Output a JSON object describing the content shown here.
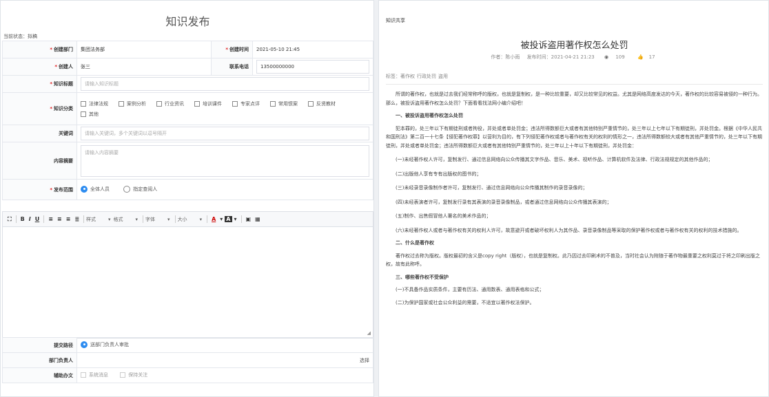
{
  "form": {
    "title": "知识发布",
    "status": "当前状态：拟稿",
    "fields": {
      "dept_label": "创建部门",
      "dept_value": "集团法务部",
      "time_label": "创建时间",
      "time_value": "2021-05-10 21:45",
      "creator_label": "创建人",
      "creator_value": "张三",
      "phone_label": "联系电话",
      "phone_value": "13500000000",
      "title_label": "知识标题",
      "title_placeholder": "请输入知识标题",
      "category_label": "知识分类",
      "categories": [
        "法律法规",
        "案例分析",
        "行业资讯",
        "培训课件",
        "专家点评",
        "常用惯案",
        "反贤教材",
        "其他"
      ],
      "keywords_label": "关键词",
      "keywords_placeholder": "请输入关键词，多个关键词以逗号隔开",
      "summary_label": "内容摘要",
      "summary_placeholder": "请输入内容摘要",
      "scope_label": "发布范围",
      "scope_options": [
        "全体人员",
        "指定查阅人"
      ]
    },
    "toolbar": {
      "bold": "B",
      "italic": "I",
      "underline": "U",
      "style_dd": "样式",
      "format_dd": "格式",
      "font_dd": "字体",
      "size_dd": "大小",
      "font_color": "A",
      "bg_color": "A"
    },
    "submit": {
      "path_label": "提交路径",
      "path_value": "送部门负责人审批",
      "head_label": "部门负责人",
      "head_select": "选择",
      "assist_label": "辅助办文",
      "assist_options": [
        "系统消息",
        "保持关注"
      ]
    }
  },
  "article": {
    "crumb": "知识共享",
    "title": "被投诉盗用著作权怎么处罚",
    "author": "作者：陈小雨",
    "time": "发布时间：2021-04-21 21:23",
    "views": "109",
    "likes": "17",
    "tags_label": "标签：",
    "tags": [
      "著作权",
      "行政处罚",
      "盗用"
    ],
    "paragraphs": [
      "所谓的著作权，也就是过去我们经常称呼的版权，也就是复制权，是一种比较重要，却又比较常见的权益。尤其是网络高度发达的今天，著作权的比较容易被侵的一种行为。那么，被投诉盗用著作权怎么处罚？下面看看找法网小编介绍吧！",
      "一、被投诉盗用著作权怎么处罚",
      "犯本罪的，处三年以下有期徒刑或者拘役，并处或者单处罚金；违法所得数额巨大或者有其他特别严重情节的，处三年以上七年以下有期徒刑，并处罚金。根据《中华人民共和国刑法》第二百一十七条【侵犯著作权罪】以营利为目的，有下列侵犯著作权或者与著作权有关的权利的情形之一，违法所得数额较大或者有其他严重情节的，处三年以下有期徒刑，并处或者单处罚金；违法所得数额巨大或者有其他特别严重情节的，处三年以上十年以下有期徒刑，并处罚金：",
      "(一)未经著作权人许可，复制发行、通过信息网络向公众传播其文字作品、音乐、美术、视听作品、计算机软件及法律、行政法规规定的其他作品的；",
      "(二)出版他人享有专有出版权的图书的；",
      "(三)未经录音录像制作者许可，复制发行、通过信息网络向公众传播其制作的录音录像的；",
      "(四)未经表演者许可，复制发行录有其表演的录音录像制品，或者通过信息网络向公众传播其表演的；",
      "(五)制作、出售假冒他人署名的美术作品的；",
      "(六)未经著作权人或者与著作权有关的权利人许可，故意避开或者破坏权利人为其作品、录音录像制品等采取的保护著作权或者与著作权有关的权利的技术措施的。",
      "二、什么是著作权",
      "著作权过去称为版权。版权最初的含义是copy right（版权），也就是复制权。此乃因过去印刷术的不普及，当时社会认为附随于著作物最重要之权利莫过于将之印刷出版之权，故有此称呼。",
      "三、哪些著作权不受保护",
      "(一)不具备作品实质条件，主要有历法、通用数表、通用表格和公式；",
      "(二)为保护国家或社会公众利益的需要，不适宜以著作权法保护。"
    ]
  },
  "colors": {
    "primary": "#2d8cf0",
    "required": "#e02020",
    "border": "#e4e7ed"
  }
}
